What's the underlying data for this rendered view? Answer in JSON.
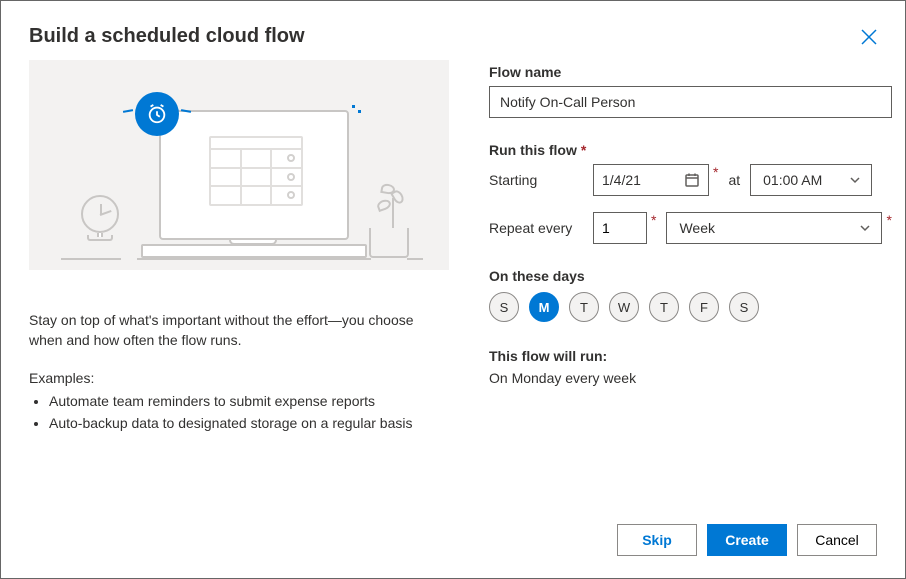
{
  "dialog": {
    "title": "Build a scheduled cloud flow"
  },
  "left": {
    "description": "Stay on top of what's important without the effort—you choose when and how often the flow runs.",
    "examples_label": "Examples:",
    "examples": [
      "Automate team reminders to submit expense reports",
      "Auto-backup data to designated storage on a regular basis"
    ]
  },
  "form": {
    "flow_name_label": "Flow name",
    "flow_name_value": "Notify On-Call Person",
    "run_label": "Run this flow",
    "starting_label": "Starting",
    "starting_date": "1/4/21",
    "at_label": "at",
    "time_value": "01:00 AM",
    "repeat_label": "Repeat every",
    "repeat_count": "1",
    "repeat_unit": "Week",
    "days_label": "On these days",
    "days": [
      {
        "abbr": "S",
        "active": false
      },
      {
        "abbr": "M",
        "active": true
      },
      {
        "abbr": "T",
        "active": false
      },
      {
        "abbr": "W",
        "active": false
      },
      {
        "abbr": "T",
        "active": false
      },
      {
        "abbr": "F",
        "active": false
      },
      {
        "abbr": "S",
        "active": false
      }
    ],
    "summary_label": "This flow will run:",
    "summary_text": "On Monday every week"
  },
  "footer": {
    "skip": "Skip",
    "create": "Create",
    "cancel": "Cancel"
  }
}
